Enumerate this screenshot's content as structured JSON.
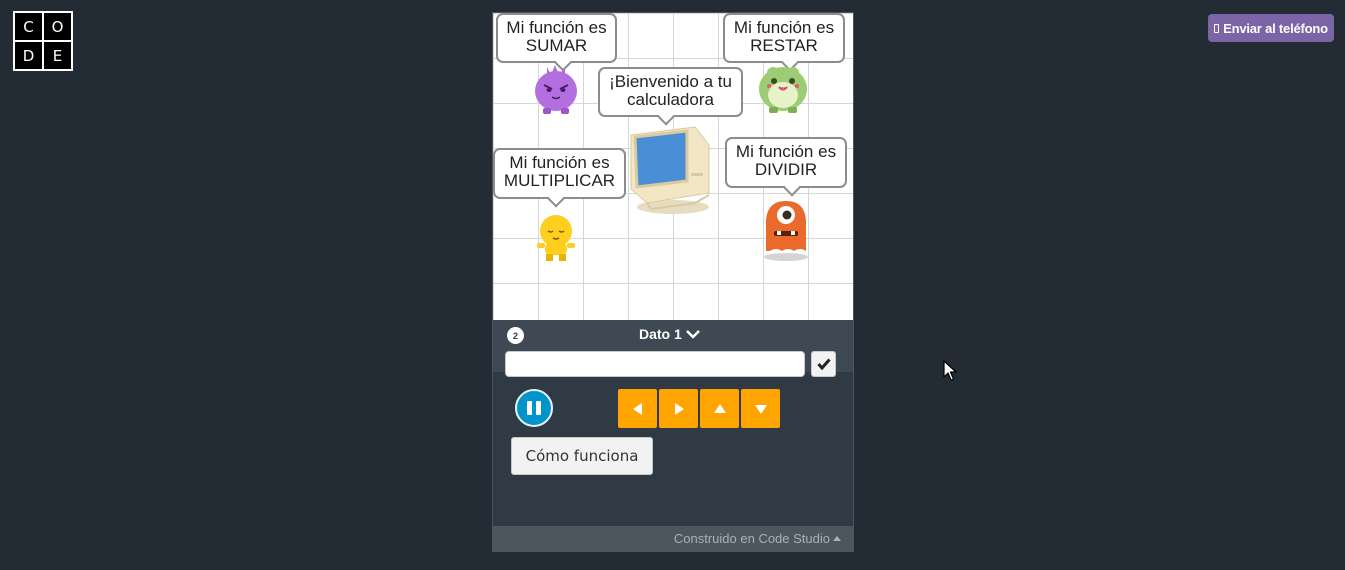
{
  "logo": {
    "letters": [
      "C",
      "O",
      "D",
      "E"
    ]
  },
  "header": {
    "send_label": "Enviar al teléfono"
  },
  "stage": {
    "bubbles": {
      "welcome": [
        "¡Bienvenido a tu",
        "calculadora"
      ],
      "add": [
        "Mi función es",
        "SUMAR"
      ],
      "subtract": [
        "Mi función es",
        "RESTAR"
      ],
      "multiply": [
        "Mi función es",
        "MULTIPLICAR"
      ],
      "divide": [
        "Mi función es",
        "DIVIDIR"
      ]
    }
  },
  "instructions": {
    "step": "2",
    "title": "Dato 1",
    "input_value": ""
  },
  "controls": {
    "how_label": "Cómo funciona"
  },
  "footer": {
    "label": "Construido en Code Studio"
  },
  "colors": {
    "background": "#232b34",
    "accent_purple": "#7c65a6",
    "arrow_orange": "#ffa400",
    "pause_blue": "#0094ca"
  },
  "icons": [
    "phone-icon",
    "chevron-down-icon",
    "check-icon",
    "pause-icon",
    "arrow-left-icon",
    "arrow-right-icon",
    "arrow-up-icon",
    "arrow-down-icon",
    "caret-up-icon",
    "mouse-cursor-icon"
  ]
}
